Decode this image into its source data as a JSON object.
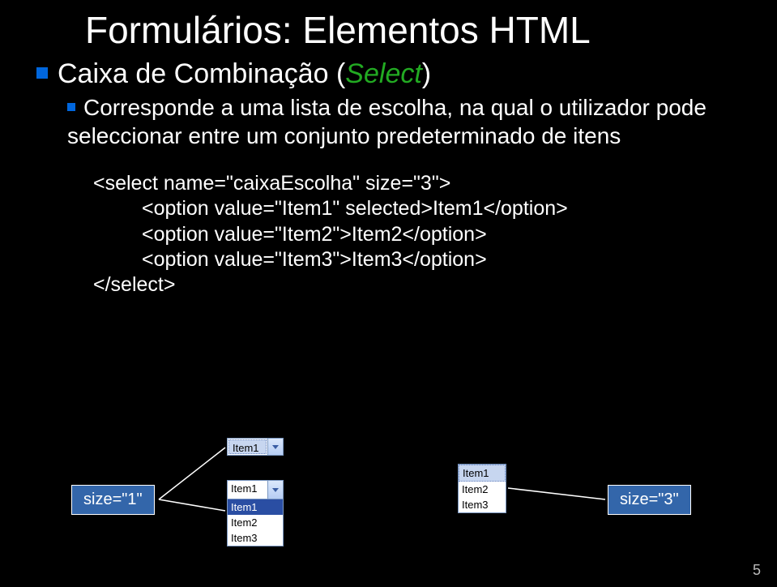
{
  "title": "Formulários: Elementos HTML",
  "subtitle_prefix": "Caixa de Combinação (",
  "subtitle_em": "Select",
  "subtitle_suffix": ")",
  "desc": "Corresponde a uma lista de escolha, na qual o utilizador pode seleccionar entre um conjunto predeterminado de itens",
  "code": {
    "open": "<select name=\"caixaEscolha\" size=\"3\">",
    "opt1": "<option value=\"Item1\" selected>Item1</option>",
    "opt2": "<option value=\"Item2\">Item2</option>",
    "opt3": "<option value=\"Item3\">Item3</option>",
    "close": "</select>"
  },
  "labels": {
    "size1": "size=\"1\"",
    "size3": "size=\"3\""
  },
  "combo": {
    "selected": "Item1",
    "item1": "Item1",
    "item2": "Item2",
    "item3": "Item3"
  },
  "page": "5"
}
